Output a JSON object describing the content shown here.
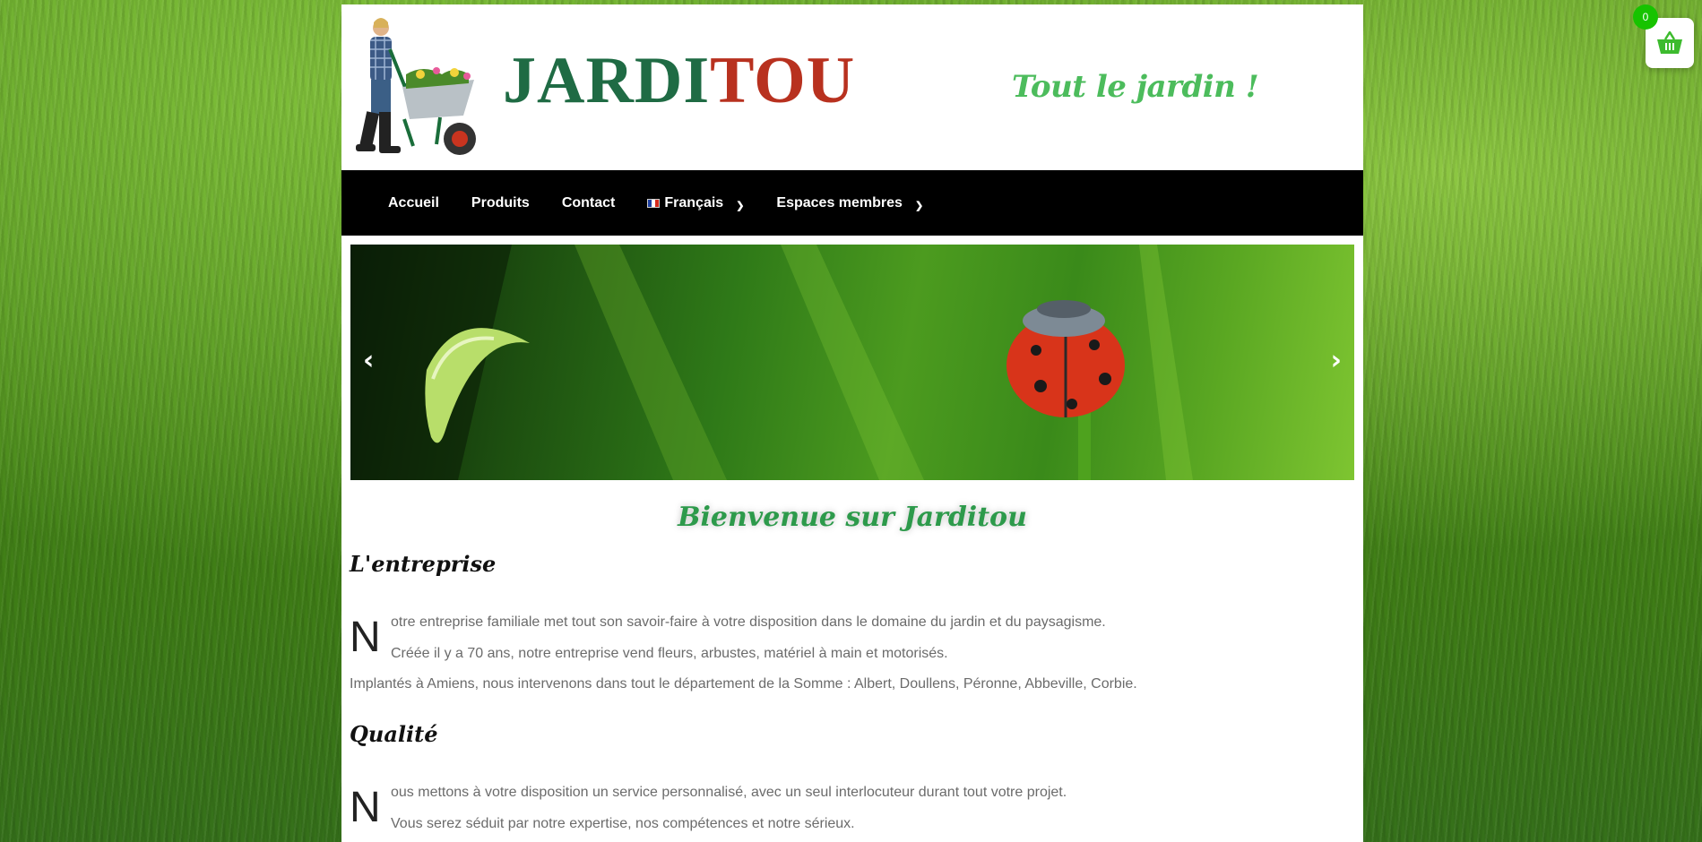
{
  "brand": {
    "logo_part1": "JARDI",
    "logo_part2": "TOU",
    "tagline": "Tout le jardin !"
  },
  "nav": {
    "items": [
      {
        "label": "Accueil"
      },
      {
        "label": "Produits"
      },
      {
        "label": "Contact"
      },
      {
        "label": "Français"
      },
      {
        "label": "Espaces membres"
      }
    ]
  },
  "cart": {
    "count": "0"
  },
  "content": {
    "welcome": "Bienvenue sur Jarditou",
    "section1": {
      "title": "L'entreprise",
      "dropcap": "N",
      "line1": "otre entreprise familiale met tout son savoir-faire à votre disposition dans le domaine du jardin et du paysagisme.",
      "line2": "Créée il y a 70 ans, notre entreprise vend fleurs, arbustes, matériel à main et motorisés.",
      "line3": "Implantés à Amiens, nous intervenons dans tout le département de la Somme : Albert, Doullens, Péronne, Abbeville, Corbie."
    },
    "section2": {
      "title": "Qualité",
      "dropcap": "N",
      "line1": "ous mettons à votre disposition un service personnalisé, avec un seul interlocuteur durant tout votre projet.",
      "line2": "Vous serez séduit par notre expertise, nos compétences et notre sérieux."
    }
  },
  "colors": {
    "accent_green": "#2d9a4b",
    "logo_green": "#1f6b44",
    "logo_red": "#b8311f",
    "nav_bg": "#000000",
    "cart_badge": "#17c300"
  },
  "icons": {
    "cart": "basket-icon",
    "prev": "chevron-left-icon",
    "next": "chevron-right-icon"
  }
}
